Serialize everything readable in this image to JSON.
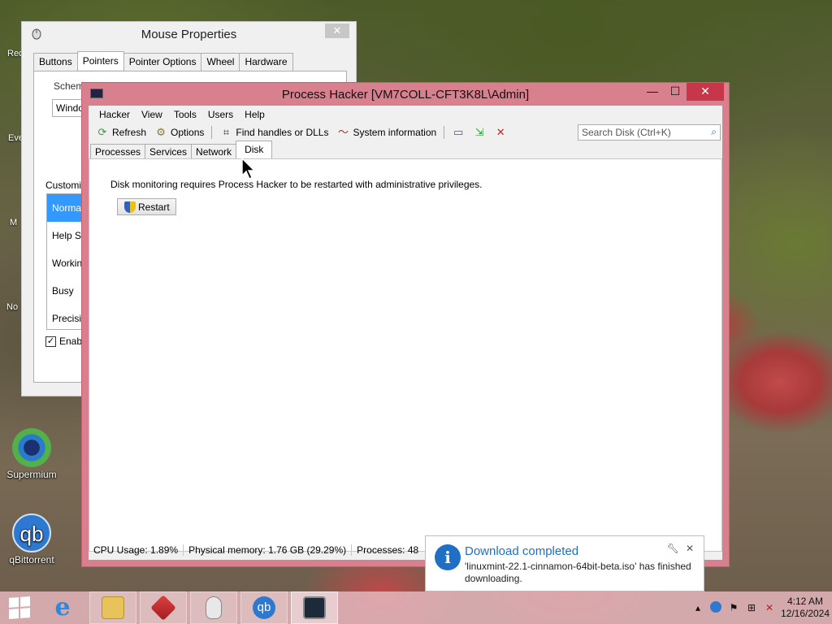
{
  "desktop": {
    "icons": [
      {
        "label": "Supermium"
      },
      {
        "label": "qBittorrent"
      }
    ],
    "fragments": [
      "Rec",
      "Eve",
      "M",
      "No"
    ]
  },
  "mouse_properties": {
    "title": "Mouse Properties",
    "close_label": "✕",
    "tabs": [
      "Buttons",
      "Pointers",
      "Pointer Options",
      "Wheel",
      "Hardware"
    ],
    "scheme_label": "Scheme",
    "scheme_value": "Windo",
    "customize_label": "Customize",
    "cursor_items": [
      "Normal S",
      "Help Se",
      "Working",
      "Busy",
      "Precision"
    ],
    "enable_label": "Enable",
    "enable_checked": true
  },
  "process_hacker": {
    "title": "Process Hacker [VM7COLL-CFT3K8L\\Admin]",
    "controls": {
      "minimize": "—",
      "maximize": "☐",
      "close": "✕"
    },
    "menu": [
      "Hacker",
      "View",
      "Tools",
      "Users",
      "Help"
    ],
    "toolbar": {
      "refresh": "Refresh",
      "options": "Options",
      "find_handles": "Find handles or DLLs",
      "system_info": "System information"
    },
    "search_placeholder": "Search Disk (Ctrl+K)",
    "tabs": [
      "Processes",
      "Services",
      "Network",
      "Disk"
    ],
    "selected_tab": "Disk",
    "disk_message": "Disk monitoring requires Process Hacker to be restarted with administrative privileges.",
    "restart_label": "Restart",
    "status": {
      "cpu": "CPU Usage: 1.89%",
      "memory": "Physical memory: 1.76 GB (29.29%)",
      "processes": "Processes: 48"
    }
  },
  "notification": {
    "title": "Download completed",
    "body": "'linuxmint-22.1-cinnamon-64bit-beta.iso' has finished downloading.",
    "settings_icon": "wrench-icon",
    "close_label": "✕"
  },
  "taskbar": {
    "apps": [
      "internet-explorer",
      "file-explorer",
      "cube-app",
      "mouse-app",
      "qbittorrent",
      "process-hacker"
    ],
    "clock_time": "4:12 AM",
    "clock_date": "12/16/2024",
    "colors": {
      "accent": "#1f6fc5",
      "taskbar": "#e2b4ba",
      "close": "#c7374a"
    }
  }
}
